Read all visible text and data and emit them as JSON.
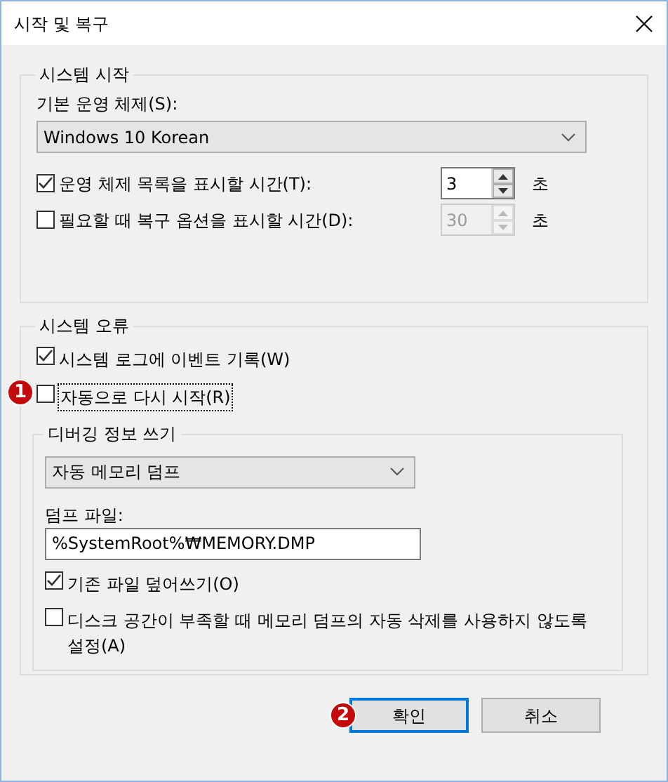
{
  "window": {
    "title": "시작 및 복구"
  },
  "startup": {
    "legend": "시스템 시작",
    "os_label": "기본 운영 체제(S):",
    "os_value": "Windows 10 Korean",
    "options": [
      {
        "label": "운영 체제 목록을 표시할 시간(T):",
        "checked": true,
        "value": "3",
        "unit": "초",
        "disabled": false
      },
      {
        "label": "필요할 때 복구 옵션을 표시할 시간(D):",
        "checked": false,
        "value": "30",
        "unit": "초",
        "disabled": true
      }
    ]
  },
  "failure": {
    "legend": "시스템 오류",
    "options": [
      {
        "label": "시스템 로그에 이벤트 기록(W)",
        "checked": true,
        "focused": false
      },
      {
        "label": "자동으로 다시 시작(R)",
        "checked": false,
        "focused": true,
        "badge": "1"
      }
    ],
    "debug": {
      "legend": "디버깅 정보 쓰기",
      "dump_type": "자동 메모리 덤프",
      "file_label": "덤프 파일:",
      "file_value": "%SystemRoot%₩MEMORY.DMP",
      "options": [
        {
          "label": "기존 파일 덮어쓰기(O)",
          "checked": true
        },
        {
          "label": "디스크 공간이 부족할 때 메모리 덤프의 자동 삭제를 사용하지 않도록 설정(A)",
          "checked": false
        }
      ]
    }
  },
  "buttons": [
    {
      "label": "확인",
      "default": true,
      "badge": "2"
    },
    {
      "label": "취소",
      "default": false
    }
  ]
}
